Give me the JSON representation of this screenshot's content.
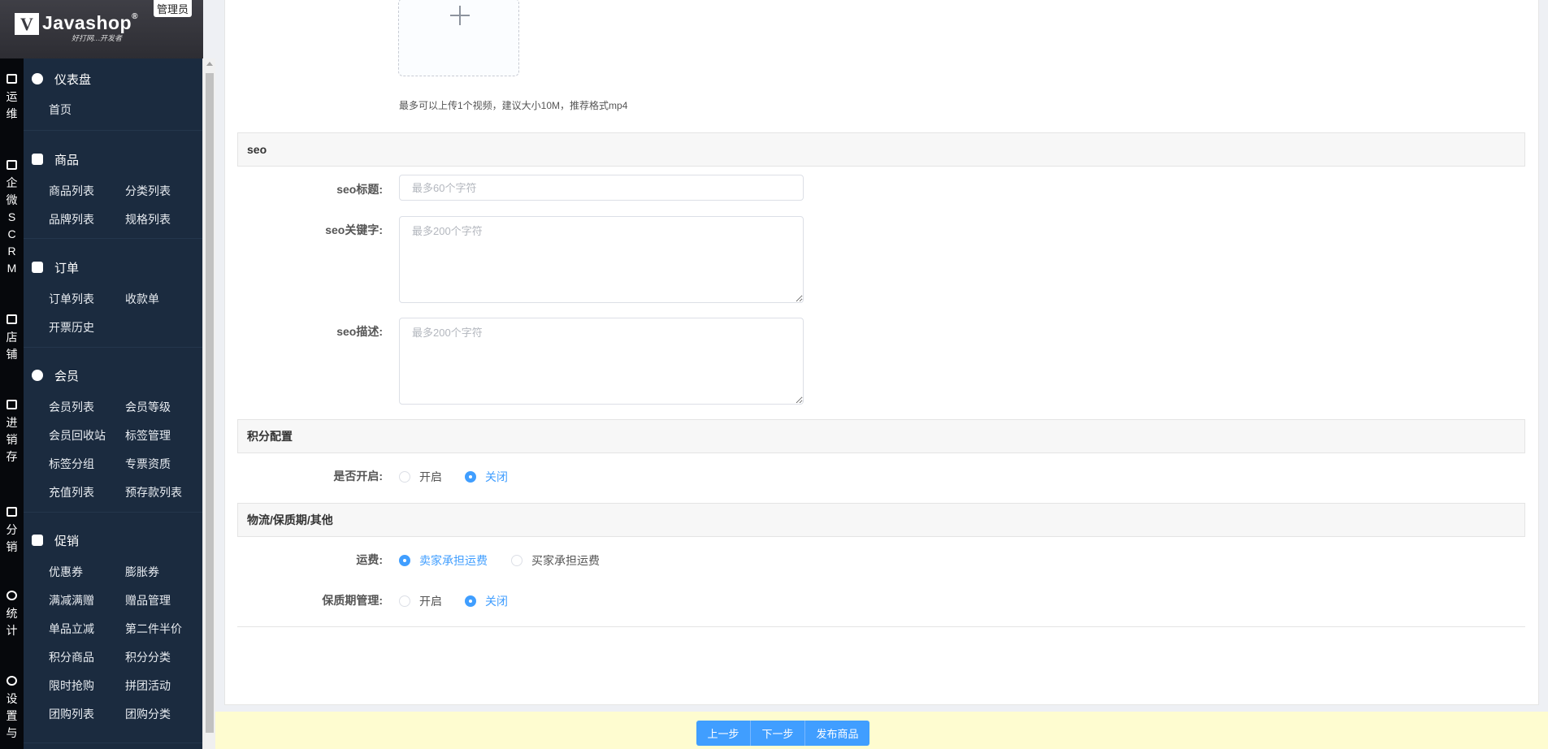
{
  "brand": {
    "mark": "V",
    "name": "Javashop",
    "reg": "®",
    "slogan": "好打网…开发者",
    "role_badge": "管理员"
  },
  "rail": [
    {
      "icon": "ops-icon",
      "label": "运维"
    },
    {
      "icon": "wecom-scrm-icon",
      "label": "企微SCRM"
    },
    {
      "icon": "store-icon",
      "label": "店铺"
    },
    {
      "icon": "inventory-icon",
      "label": "进销存"
    },
    {
      "icon": "distribution-icon",
      "label": "分销"
    },
    {
      "icon": "statistics-icon",
      "label": "统计"
    },
    {
      "icon": "settings-icon",
      "label": "设置与"
    }
  ],
  "sidebar": {
    "groups": [
      {
        "icon": "dashboard-icon",
        "title": "仪表盘",
        "items": [
          "首页"
        ]
      },
      {
        "icon": "goods-icon",
        "title": "商品",
        "items": [
          "商品列表",
          "分类列表",
          "品牌列表",
          "规格列表"
        ]
      },
      {
        "icon": "order-icon",
        "title": "订单",
        "items": [
          "订单列表",
          "收款单",
          "开票历史"
        ]
      },
      {
        "icon": "member-icon",
        "title": "会员",
        "items": [
          "会员列表",
          "会员等级",
          "会员回收站",
          "标签管理",
          "标签分组",
          "专票资质",
          "充值列表",
          "预存款列表"
        ]
      },
      {
        "icon": "promotion-icon",
        "title": "促销",
        "items": [
          "优惠券",
          "膨胀券",
          "满减满赠",
          "赠品管理",
          "单品立减",
          "第二件半价",
          "积分商品",
          "积分分类",
          "限时抢购",
          "拼团活动",
          "团购列表",
          "团购分类"
        ]
      }
    ]
  },
  "form": {
    "video_hint": "最多可以上传1个视频，建议大小10M，推荐格式mp4",
    "seo": {
      "section_title": "seo",
      "title_label": "seo标题:",
      "title_placeholder": "最多60个字符",
      "keywords_label": "seo关键字:",
      "keywords_placeholder": "最多200个字符",
      "desc_label": "seo描述:",
      "desc_placeholder": "最多200个字符"
    },
    "points": {
      "section_title": "积分配置",
      "enable_label": "是否开启:",
      "options": [
        "开启",
        "关闭"
      ],
      "selected": "关闭"
    },
    "logistics": {
      "section_title": "物流/保质期/其他",
      "freight_label": "运费:",
      "freight_options": [
        "卖家承担运费",
        "买家承担运费"
      ],
      "freight_selected": "卖家承担运费",
      "warranty_label": "保质期管理:",
      "warranty_options": [
        "开启",
        "关闭"
      ],
      "warranty_selected": "关闭"
    }
  },
  "footer": {
    "prev_label": "上一步",
    "next_label": "下一步",
    "publish_label": "发布商品"
  },
  "colors": {
    "accent": "#409eff",
    "sidebar_bg": "#1b2b3f",
    "rail_bg": "#06080c",
    "bottom_bar_bg": "#fefcd0"
  }
}
